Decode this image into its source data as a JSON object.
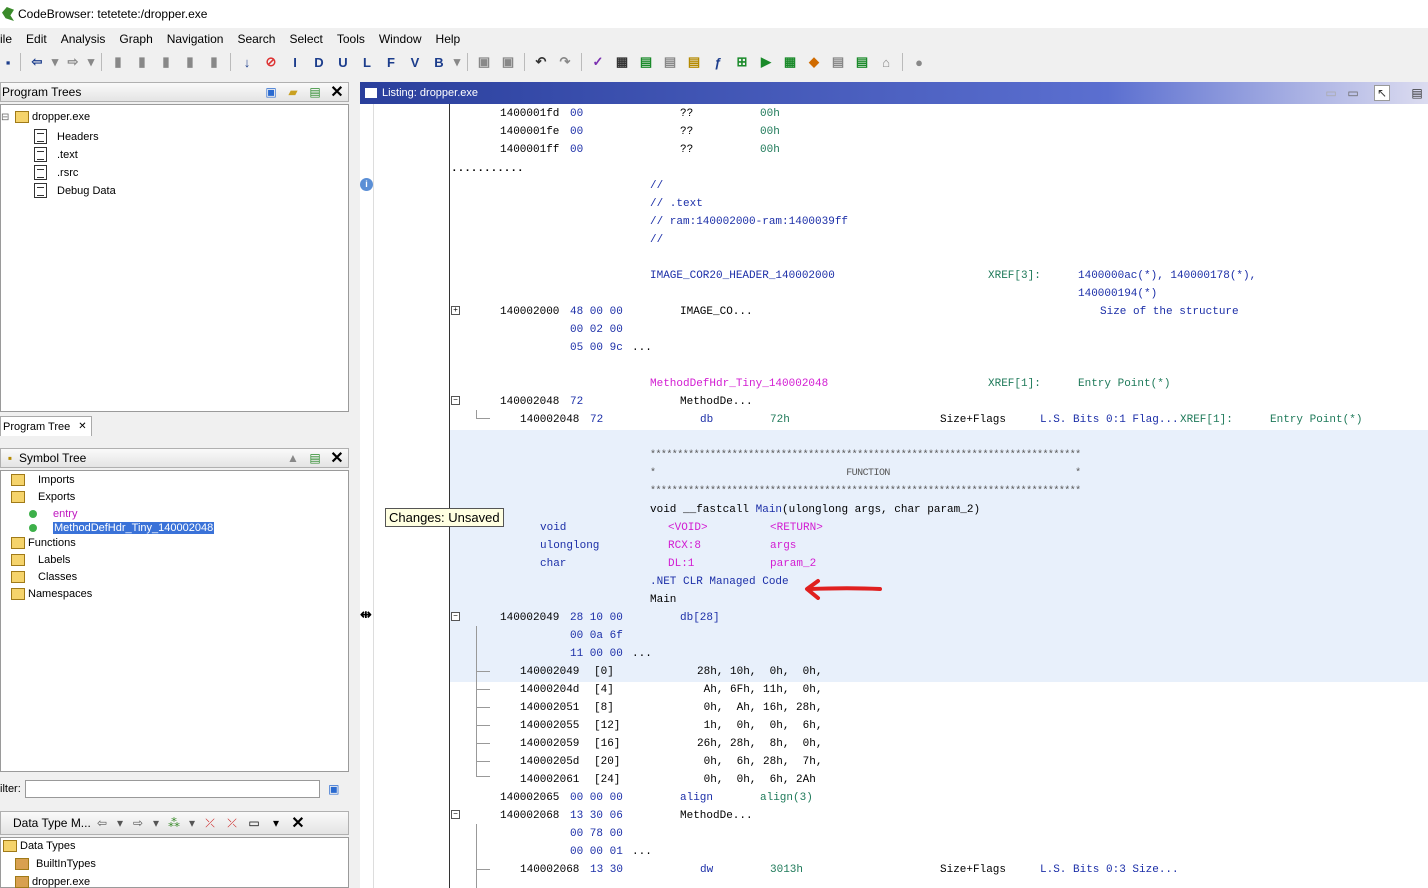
{
  "window": {
    "title": "CodeBrowser: tetetete:/dropper.exe"
  },
  "menu": [
    "ile",
    "Edit",
    "Analysis",
    "Graph",
    "Navigation",
    "Search",
    "Select",
    "Tools",
    "Window",
    "Help"
  ],
  "program_trees": {
    "title": "Program Trees",
    "root": "dropper.exe",
    "children": [
      "Headers",
      ".text",
      ".rsrc",
      "Debug Data"
    ],
    "tab": "Program Tree"
  },
  "symbol_tree": {
    "title": "Symbol Tree",
    "nodes": {
      "imports": "Imports",
      "exports": "Exports",
      "entry": "entry",
      "method": "MethodDefHdr_Tiny_140002048",
      "functions": "Functions",
      "labels": "Labels",
      "classes": "Classes",
      "namespaces": "Namespaces"
    }
  },
  "filter": {
    "label": "ilter:",
    "value": ""
  },
  "data_types": {
    "title": "Data Type M...",
    "root": "Data Types",
    "children": [
      "BuiltInTypes",
      "dropper.exe"
    ]
  },
  "tooltip": "Changes: Unsaved",
  "listing": {
    "title": "Listing:  dropper.exe",
    "lines": [
      {
        "t": 114,
        "addr": "1400001fd",
        "bytes": "00",
        "mn": "??",
        "op": "00h"
      },
      {
        "t": 132,
        "addr": "1400001fe",
        "bytes": "00",
        "mn": "??",
        "op": "00h"
      },
      {
        "t": 150,
        "addr": "1400001ff",
        "bytes": "00",
        "mn": "??",
        "op": "00h"
      }
    ],
    "dots": "...........",
    "comment1": "//",
    "comment2": "// .text",
    "comment3": "// ram:140002000-ram:1400039ff",
    "comment4": "//",
    "cor20_label": "IMAGE_COR20_HEADER_140002000",
    "cor20_xref": "XREF[3]:",
    "cor20_xref_vals": "1400000ac(*), 140000178(*),",
    "cor20_xref_vals2": "140000194(*)",
    "cor20_addr": "140002000",
    "cor20_bytes1": "48 00 00",
    "cor20_bytes2": "00 02 00",
    "cor20_bytes3": "05 00 9c",
    "cor20_more": "...",
    "cor20_mn": "IMAGE_CO...",
    "cor20_comment": "Size of the structure",
    "mdh_label": "MethodDefHdr_Tiny_140002048",
    "mdh_xref": "XREF[1]:",
    "mdh_xref_val": "Entry Point(*)",
    "mdh_addr": "140002048",
    "mdh_bytes": "72",
    "mdh_mn": "MethodDe...",
    "mdh_sub_addr": "140002048",
    "mdh_sub_bytes": "72",
    "mdh_sub_mn": "db",
    "mdh_sub_op": "72h",
    "mdh_sub_field": "Size+Flags",
    "mdh_sub_cmt": "L.S. Bits 0:1 Flag...",
    "mdh_sub_xref": "XREF[1]:",
    "mdh_sub_xref_val": "Entry Point(*)",
    "stars1": "*******************************************************************************",
    "fn_banner": "*                                   FUNCTION                                  *",
    "stars2": "*******************************************************************************",
    "sig_void": "void __fastcall ",
    "sig_main": "Main",
    "sig_rest": "(ulonglong args, char param_2)",
    "params": [
      {
        "type": "void",
        "loc": "<VOID>",
        "name": "<RETURN>"
      },
      {
        "type": "ulonglong",
        "loc": "RCX:8",
        "name": "args"
      },
      {
        "type": "char",
        "loc": "DL:1",
        "name": "param_2"
      }
    ],
    "net_clr": ".NET CLR Managed Code",
    "main_label": "Main",
    "db28_addr": "140002049",
    "db28_bytes1": "28 10 00",
    "db28_bytes2": "00 0a 6f",
    "db28_bytes3": "11 00 00",
    "db28_more": "...",
    "db28_mn": "db[28]",
    "arr": [
      {
        "addr": "140002049",
        "idx": "[0]",
        "vals": "28h, 10h,  0h,  0h,"
      },
      {
        "addr": "14000204d",
        "idx": "[4]",
        "vals": " Ah, 6Fh, 11h,  0h,"
      },
      {
        "addr": "140002051",
        "idx": "[8]",
        "vals": " 0h,  Ah, 16h, 28h,"
      },
      {
        "addr": "140002055",
        "idx": "[12]",
        "vals": " 1h,  0h,  0h,  6h,"
      },
      {
        "addr": "140002059",
        "idx": "[16]",
        "vals": "26h, 28h,  8h,  0h,"
      },
      {
        "addr": "14000205d",
        "idx": "[20]",
        "vals": " 0h,  6h, 28h,  7h,"
      },
      {
        "addr": "140002061",
        "idx": "[24]",
        "vals": " 0h,  0h,  6h, 2Ah"
      }
    ],
    "align_addr": "140002065",
    "align_bytes": "00 00 00",
    "align_mn": "align",
    "align_op": "align(3)",
    "m2_addr": "140002068",
    "m2_bytes1": "13 30 06",
    "m2_bytes2": "00 78 00",
    "m2_bytes3": "00 00 01",
    "m2_more": "...",
    "m2_mn": "MethodDe...",
    "m2_sub_addr": "140002068",
    "m2_sub_bytes": "13 30",
    "m2_sub_mn": "dw",
    "m2_sub_op": "3013h",
    "m2_sub_field": "Size+Flags",
    "m2_sub_cmt": "L.S. Bits 0:3 Size..."
  }
}
